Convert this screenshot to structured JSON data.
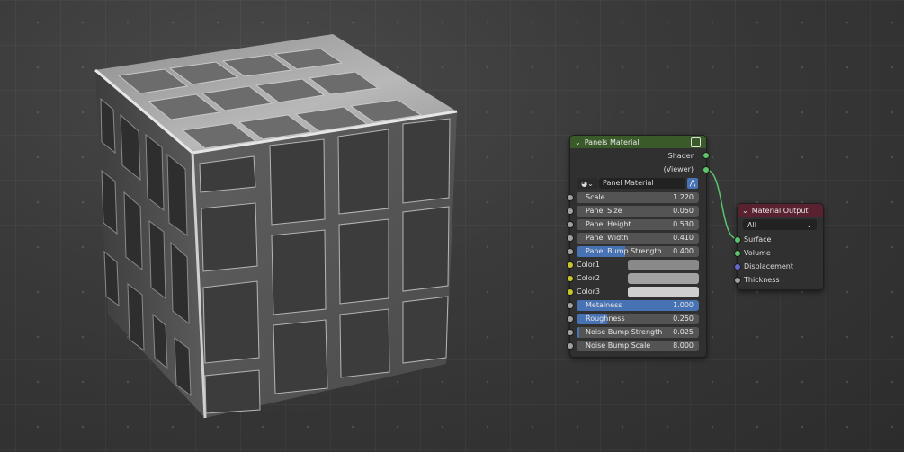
{
  "panels_node": {
    "title": "Panels Material",
    "header_color": "#3a5a2a",
    "outputs": [
      "Shader",
      "(Viewer)"
    ],
    "material_selector": "Panel Material",
    "params": [
      {
        "label": "Scale",
        "value": "1.220",
        "fill": 0
      },
      {
        "label": "Panel Size",
        "value": "0.050",
        "fill": 0
      },
      {
        "label": "Panel Height",
        "value": "0.530",
        "fill": 0
      },
      {
        "label": "Panel Width",
        "value": "0.410",
        "fill": 0
      },
      {
        "label": "Panel Bump Strength",
        "value": "0.400",
        "fill": 0.4
      }
    ],
    "colors": [
      {
        "label": "Color1",
        "swatch": "#8a8a8a"
      },
      {
        "label": "Color2",
        "swatch": "#a2a2a2"
      },
      {
        "label": "Color3",
        "swatch": "#cfcfcf"
      }
    ],
    "params2": [
      {
        "label": "Metalness",
        "value": "1.000",
        "fill": 1.0
      },
      {
        "label": "Roughness",
        "value": "0.250",
        "fill": 0.25
      },
      {
        "label": "Noise Bump Strength",
        "value": "0.025",
        "fill": 0.025
      },
      {
        "label": "Noise Bump Scale",
        "value": "8.000",
        "fill": 0
      }
    ]
  },
  "output_node": {
    "title": "Material Output",
    "header_color": "#5a2230",
    "target": "All",
    "inputs": [
      {
        "label": "Surface",
        "socket": "#5ec46a"
      },
      {
        "label": "Volume",
        "socket": "#5ec46a"
      },
      {
        "label": "Displacement",
        "socket": "#6367d0"
      },
      {
        "label": "Thickness",
        "socket": "#a1a1a1"
      }
    ]
  },
  "colors": {
    "shader_socket": "#5ec46a",
    "value_socket": "#a1a1a1",
    "color_socket": "#c7c729",
    "accent": "#4772b3"
  }
}
